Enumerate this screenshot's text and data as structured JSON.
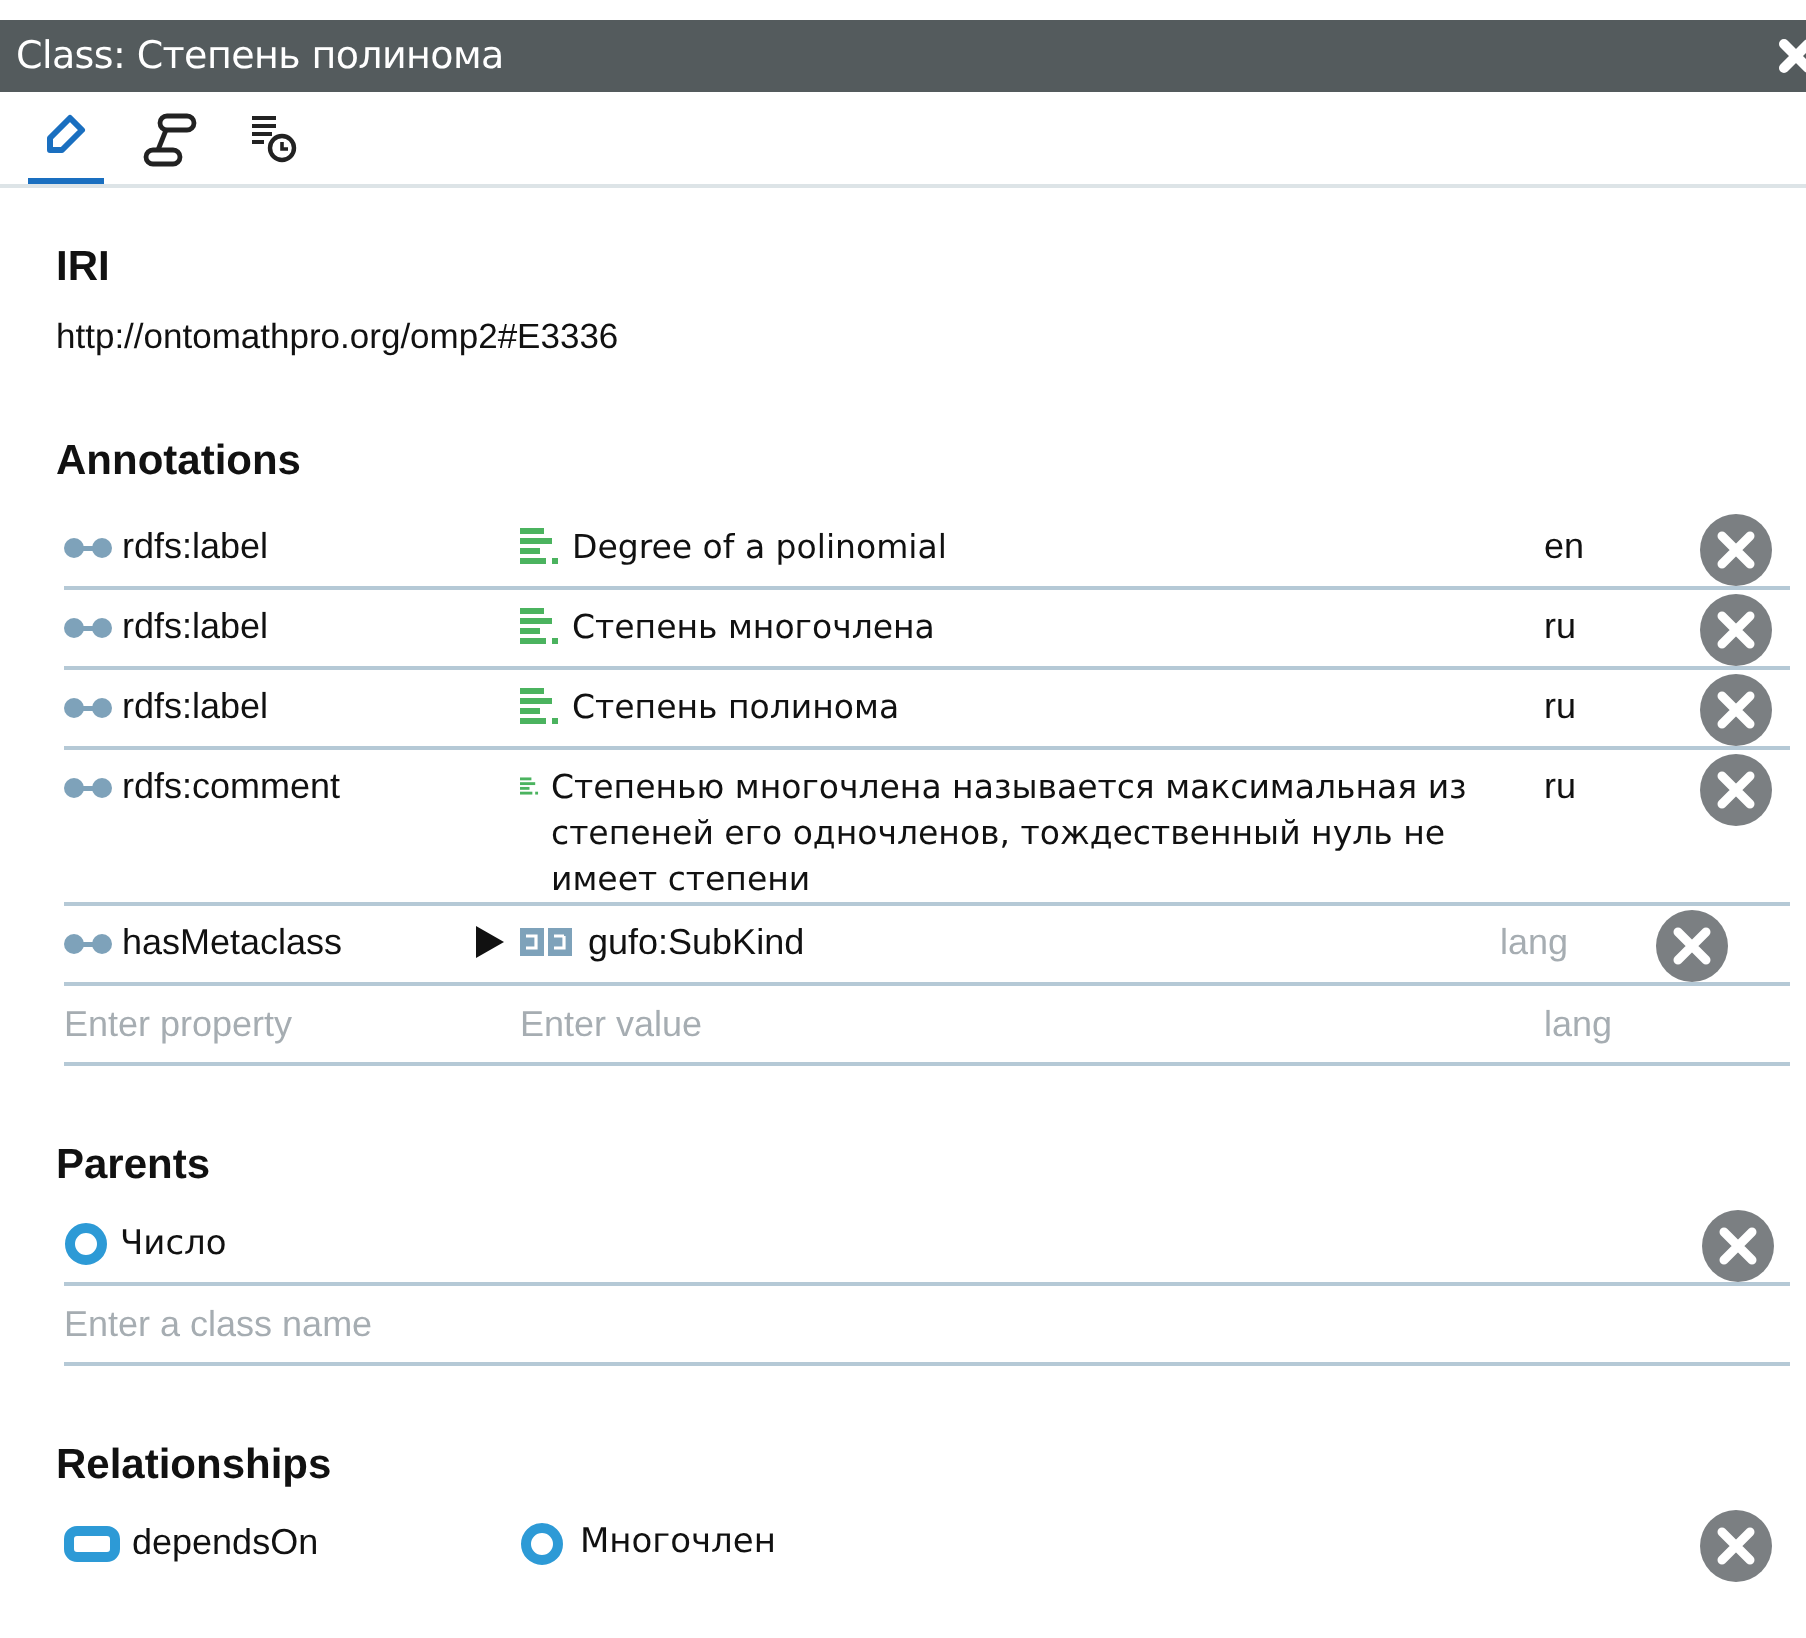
{
  "window": {
    "title": "Class: Степень полинома"
  },
  "tabs": [
    {
      "kind": "edit",
      "selected": true
    },
    {
      "kind": "graph",
      "selected": false
    },
    {
      "kind": "history",
      "selected": false
    }
  ],
  "iri": {
    "heading": "IRI",
    "value": "http://ontomathpro.org/omp2#E3336"
  },
  "annotations": {
    "heading": "Annotations",
    "rows": [
      {
        "kind": "literal",
        "property": "rdfs:label",
        "value": "Degree of a polinomial",
        "lang": "en"
      },
      {
        "kind": "literal",
        "property": "rdfs:label",
        "value": "Степень многочлена",
        "lang": "ru"
      },
      {
        "kind": "literal",
        "property": "rdfs:label",
        "value": "Степень полинома",
        "lang": "ru"
      },
      {
        "kind": "literal",
        "property": "rdfs:comment",
        "value": "Степенью многочлена называется максимальная из степеней его одночленов, тождественный нуль не имеет степени",
        "lang": "ru"
      },
      {
        "kind": "entity",
        "property": "hasMetaclass",
        "value": "gufo:SubKind",
        "expanded": false,
        "lang_placeholder": "lang"
      }
    ],
    "new_row": {
      "property_placeholder": "Enter property",
      "value_placeholder": "Enter value",
      "lang_placeholder": "lang"
    }
  },
  "parents": {
    "heading": "Parents",
    "items": [
      {
        "name": "Число"
      }
    ],
    "placeholder": "Enter a class name"
  },
  "relationships": {
    "heading": "Relationships",
    "items": [
      {
        "property": "dependsOn",
        "target": "Многочлен"
      }
    ]
  }
}
